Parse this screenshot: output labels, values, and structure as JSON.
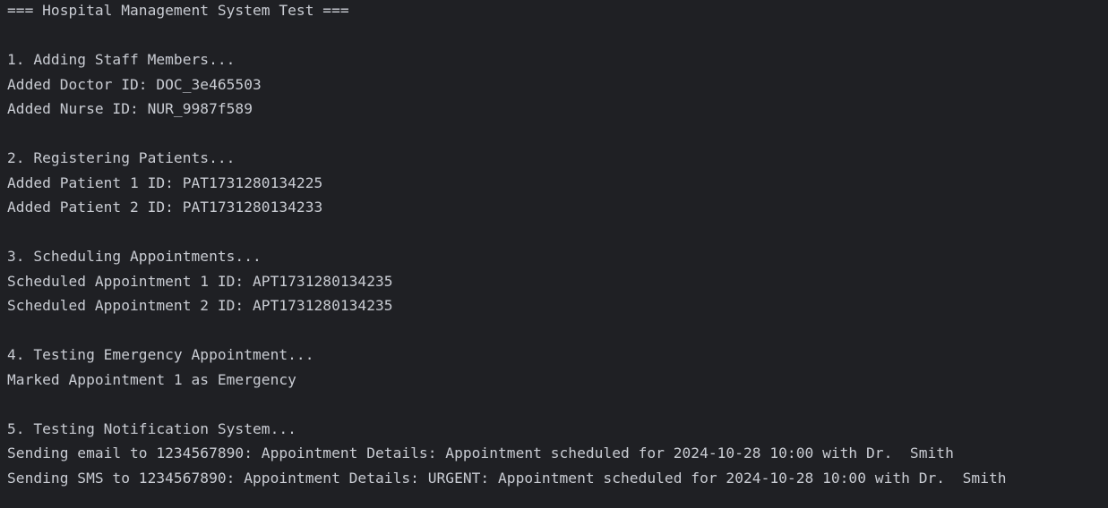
{
  "console": {
    "lines": [
      "=== Hospital Management System Test ===",
      "",
      "1. Adding Staff Members...",
      "Added Doctor ID: DOC_3e465503",
      "Added Nurse ID: NUR_9987f589",
      "",
      "2. Registering Patients...",
      "Added Patient 1 ID: PAT1731280134225",
      "Added Patient 2 ID: PAT1731280134233",
      "",
      "3. Scheduling Appointments...",
      "Scheduled Appointment 1 ID: APT1731280134235",
      "Scheduled Appointment 2 ID: APT1731280134235",
      "",
      "4. Testing Emergency Appointment...",
      "Marked Appointment 1 as Emergency",
      "",
      "5. Testing Notification System...",
      "Sending email to 1234567890: Appointment Details: Appointment scheduled for 2024-10-28 10:00 with Dr.  Smith",
      "Sending SMS to 1234567890: Appointment Details: URGENT: Appointment scheduled for 2024-10-28 10:00 with Dr.  Smith"
    ]
  },
  "colors": {
    "background": "#1f2024",
    "text": "#c9ccd3"
  }
}
